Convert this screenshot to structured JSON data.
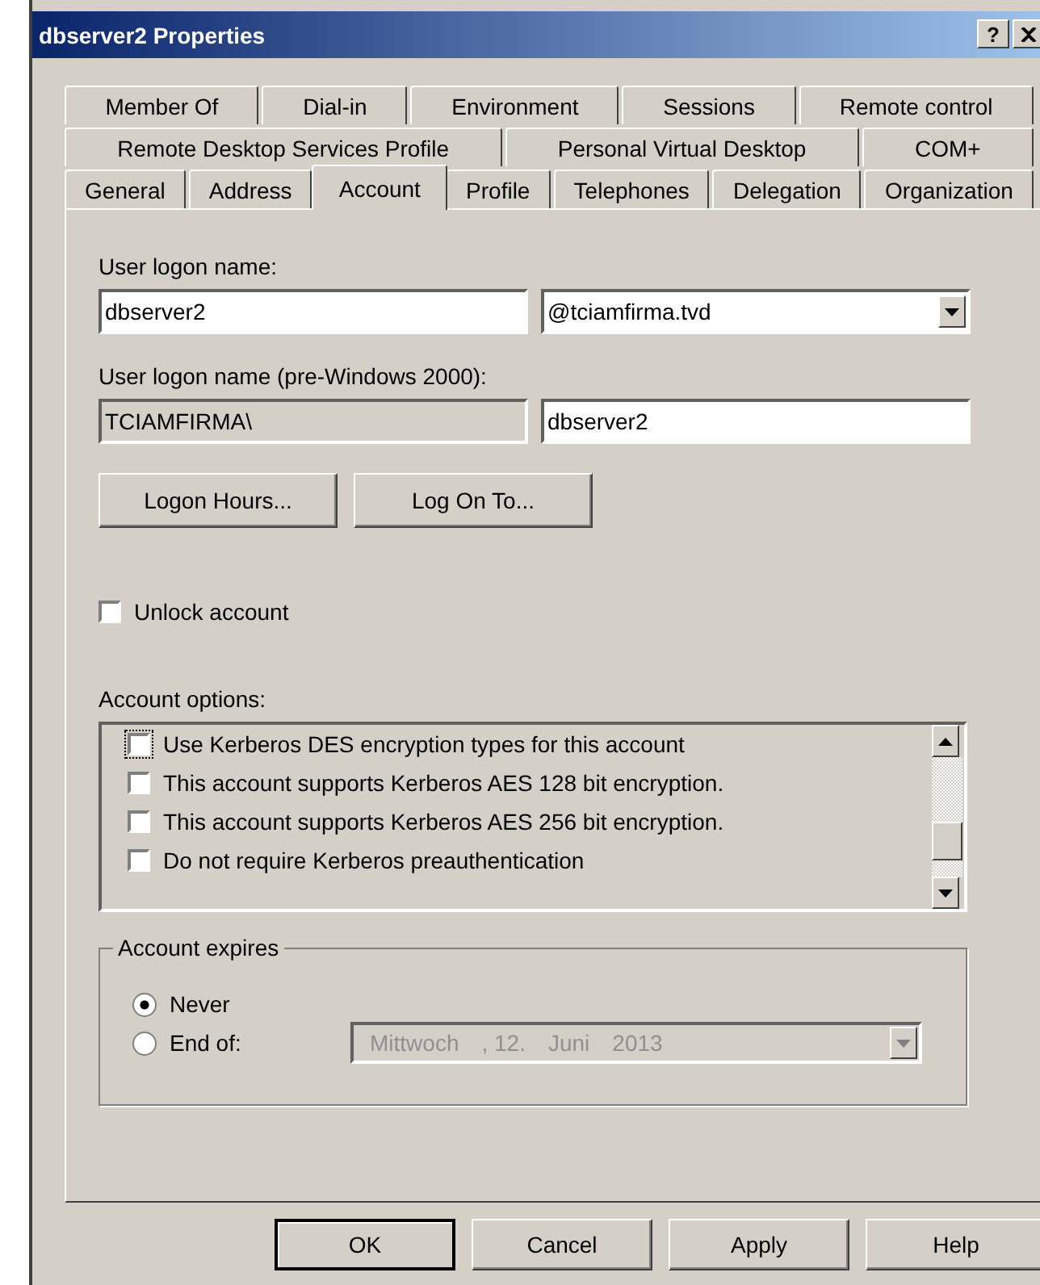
{
  "window": {
    "title": "dbserver2 Properties",
    "help_button": "?"
  },
  "tab_rows": [
    [
      {
        "label": "Member Of",
        "selected": false
      },
      {
        "label": "Dial-in",
        "selected": false
      },
      {
        "label": "Environment",
        "selected": false
      },
      {
        "label": "Sessions",
        "selected": false
      },
      {
        "label": "Remote control",
        "selected": false
      }
    ],
    [
      {
        "label": "Remote Desktop Services Profile",
        "selected": false
      },
      {
        "label": "Personal Virtual Desktop",
        "selected": false
      },
      {
        "label": "COM+",
        "selected": false
      }
    ],
    [
      {
        "label": "General",
        "selected": false
      },
      {
        "label": "Address",
        "selected": false
      },
      {
        "label": "Account",
        "selected": true
      },
      {
        "label": "Profile",
        "selected": false
      },
      {
        "label": "Telephones",
        "selected": false
      },
      {
        "label": "Delegation",
        "selected": false
      },
      {
        "label": "Organization",
        "selected": false
      }
    ]
  ],
  "logon": {
    "label": "User logon name:",
    "value": "dbserver2",
    "domain": "@tciamfirma.tvd"
  },
  "pre2000": {
    "label": "User logon name (pre-Windows 2000):",
    "domain": "TCIAMFIRMA\\",
    "value": "dbserver2"
  },
  "action_buttons": [
    "Logon Hours...",
    "Log On To..."
  ],
  "unlock": {
    "label": "Unlock account",
    "checked": false
  },
  "account_options": {
    "label": "Account options:",
    "items": [
      {
        "label": "Use Kerberos DES encryption types for this account",
        "checked": false,
        "focused": true
      },
      {
        "label": "This account supports Kerberos AES 128 bit encryption.",
        "checked": false,
        "focused": false
      },
      {
        "label": "This account supports Kerberos AES 256 bit encryption.",
        "checked": false,
        "focused": false
      },
      {
        "label": "Do not require Kerberos preauthentication",
        "checked": false,
        "focused": false
      }
    ]
  },
  "account_expires": {
    "label": "Account expires",
    "options": [
      {
        "label": "Never",
        "selected": true
      },
      {
        "label": "End of:",
        "selected": false
      }
    ],
    "date": {
      "disabled": true,
      "parts": [
        "Mittwoch",
        ", 12.",
        "Juni",
        "2013"
      ]
    }
  },
  "buttons": [
    {
      "label": "OK",
      "default": true
    },
    {
      "label": "Cancel",
      "default": false
    },
    {
      "label": "Apply",
      "default": false
    },
    {
      "label": "Help",
      "default": false
    }
  ]
}
